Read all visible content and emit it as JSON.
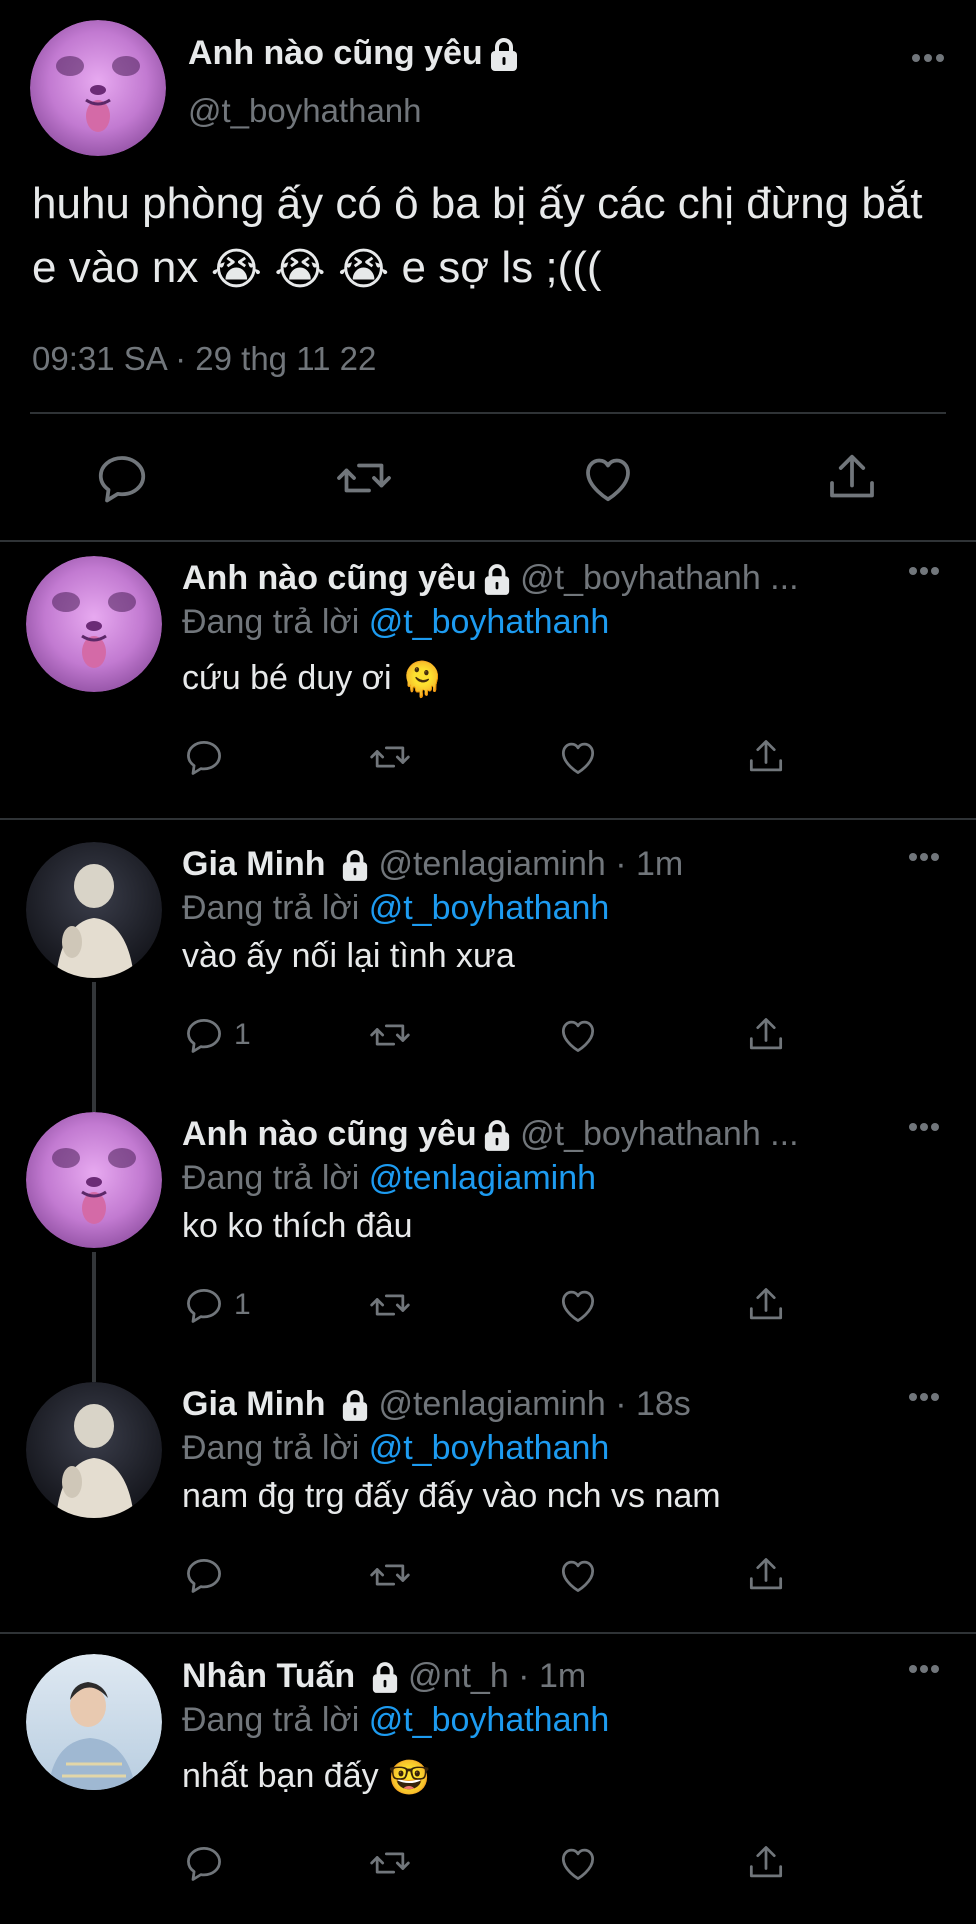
{
  "main_tweet": {
    "display_name": "Anh nào cũng yêu",
    "handle": "@t_boyhathanh",
    "text": "huhu phòng ấy có ô ba bị ấy các chị đừng bắt e vào nx",
    "text_suffix": "e sợ ls ;(((",
    "emoji": [
      "😭",
      "😭",
      "😭"
    ],
    "timestamp": "09:31 SA · 29 thg 11 22",
    "icons": [
      "reply-icon",
      "retweet-icon",
      "like-icon",
      "share-icon"
    ]
  },
  "reply_label": "Đang trả lời",
  "replies": [
    {
      "display_name": "Anh nào cũng yêu",
      "meta": "@t_boyhathanh ...",
      "replying_to": "@t_boyhathanh",
      "text": "cứu bé duy ơi",
      "emoji": "🫠",
      "reply_count": ""
    },
    {
      "display_name": "Gia Minh",
      "meta": "@tenlagiaminh · 1m",
      "replying_to": "@t_boyhathanh",
      "text": "vào ấy nối lại tình xưa",
      "reply_count": "1"
    },
    {
      "display_name": "Anh nào cũng yêu",
      "meta": "@t_boyhathanh ...",
      "replying_to": "@tenlagiaminh",
      "text": "ko ko thích đâu",
      "reply_count": "1"
    },
    {
      "display_name": "Gia Minh",
      "meta": "@tenlagiaminh · 18s",
      "replying_to": "@t_boyhathanh",
      "text": "nam đg trg đấy đấy vào nch vs nam",
      "reply_count": ""
    },
    {
      "display_name": "Nhân Tuấn",
      "meta": "@nt_h · 1m",
      "replying_to": "@t_boyhathanh",
      "text": "nhất bạn đấy",
      "emoji": "🤓",
      "reply_count": ""
    }
  ],
  "colors": {
    "background": "#000000",
    "text": "#e7e9ea",
    "muted": "#71767b",
    "link": "#1d9bf0",
    "divider": "#2f3336"
  }
}
